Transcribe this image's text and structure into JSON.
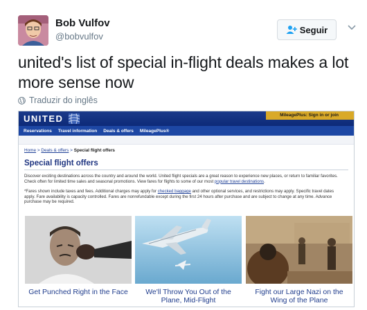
{
  "tweet": {
    "display_name": "Bob Vulfov",
    "handle": "@bobvulfov",
    "follow_label": "Seguir",
    "text": "united's list of special in-flight deals makes a lot more sense now",
    "translate_label": "Traduzir do inglês"
  },
  "media": {
    "logo": "UNITED",
    "mileageplus_signin": "MileagePlus: Sign in or join",
    "nav": [
      "Reservations",
      "Travel information",
      "Deals & offers",
      "MileagePlus®"
    ],
    "breadcrumb": {
      "home": "Home",
      "sep": ">",
      "deals": "Deals & offers",
      "current": "Special flight offers"
    },
    "heading": "Special flight offers",
    "para1": "Discover exciting destinations across the country and around the world. United flight specials are a great reason to experience new places, or return to familiar favorites. Check often for limited time sales and seasonal promotions. View fares for flights to some of our most",
    "para1_link": "popular travel destinations",
    "para2_a": "*Fares shown include taxes and fees. Additional charges may apply for",
    "para2_link": "checked baggage",
    "para2_b": "and other optional services, and restrictions may apply. Specific travel dates apply. Fare availability is capacity controlled. Fares are nonrefundable except during the first 24 hours after purchase and are subject to change at any time. Advance purchase may be required.",
    "offers": [
      {
        "caption": "Get Punched Right in the Face"
      },
      {
        "caption": "We'll Throw You Out of the Plane, Mid-Flight"
      },
      {
        "caption": "Fight our Large Nazi on the Wing of the Plane"
      }
    ]
  },
  "colors": {
    "united_blue": "#1d47a4",
    "united_dark": "#0d2a78",
    "mileageplus_gold": "#d9a928",
    "link_blue": "#1f3c8c",
    "twitter_gray": "#657786"
  },
  "icons": {
    "follow": "add-user-icon",
    "caret": "chevron-down-icon",
    "translate": "globe-icon"
  }
}
